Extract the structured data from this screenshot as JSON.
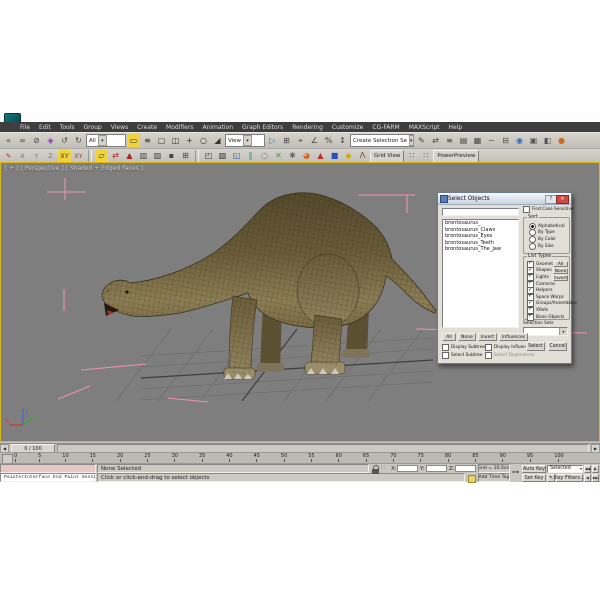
{
  "menu": {
    "items": [
      "File",
      "Edit",
      "Tools",
      "Group",
      "Views",
      "Create",
      "Modifiers",
      "Animation",
      "Graph Editors",
      "Rendering",
      "Customize",
      "CG-FARM",
      "MAXScript",
      "Help"
    ]
  },
  "toolbar1": {
    "selection_filter": "All",
    "ref_coord": "View",
    "named_sel": "Create Selection Se",
    "icons_a": [
      {
        "n": "flyout-collapse",
        "g": "«",
        "c": "#444"
      },
      {
        "n": "select-and-link",
        "g": "∞",
        "c": "#444"
      },
      {
        "n": "unlink-selection",
        "g": "⊘",
        "c": "#444"
      },
      {
        "n": "bind-to-space-warp",
        "g": "◈",
        "c": "#8a2fc0"
      },
      {
        "n": "undo",
        "g": "↺",
        "c": "#444"
      },
      {
        "n": "redo",
        "g": "↻",
        "c": "#444"
      }
    ],
    "icons_b": [
      {
        "n": "select-object",
        "g": "▭",
        "c": "#333",
        "b": "#f2d23a"
      },
      {
        "n": "select-by-name",
        "g": "≡",
        "c": "#333"
      },
      {
        "n": "rect-selection-region",
        "g": "▢",
        "c": "#333"
      },
      {
        "n": "window-crossing-toggle",
        "g": "◫",
        "c": "#333"
      },
      {
        "n": "select-and-move",
        "g": "+",
        "c": "#333"
      },
      {
        "n": "select-and-rotate",
        "g": "○",
        "c": "#333"
      },
      {
        "n": "select-and-scale",
        "g": "◢",
        "c": "#333"
      }
    ],
    "icons_c": [
      {
        "n": "select-and-manipulate",
        "g": "▷",
        "c": "#2a7ab0"
      },
      {
        "n": "keyboard-override",
        "g": "⊞",
        "c": "#444"
      },
      {
        "n": "snaps-toggle",
        "g": "⌖",
        "c": "#444"
      },
      {
        "n": "angle-snap",
        "g": "∠",
        "c": "#444"
      },
      {
        "n": "percent-snap",
        "g": "%",
        "c": "#444"
      },
      {
        "n": "spinner-snap",
        "g": "↕",
        "c": "#444"
      }
    ],
    "icons_d": [
      {
        "n": "edit-named-sets",
        "g": "✎",
        "c": "#444"
      },
      {
        "n": "mirror",
        "g": "⇄",
        "c": "#444"
      },
      {
        "n": "align",
        "g": "≡",
        "c": "#444"
      },
      {
        "n": "layer-manager",
        "g": "▤",
        "c": "#444"
      },
      {
        "n": "graphite-ribbon",
        "g": "▦",
        "c": "#444"
      },
      {
        "n": "curve-editor",
        "g": "~",
        "c": "#444"
      },
      {
        "n": "schematic-view",
        "g": "⊟",
        "c": "#444"
      },
      {
        "n": "material-editor",
        "g": "◉",
        "c": "#2f6db8"
      },
      {
        "n": "render-setup",
        "g": "▣",
        "c": "#555"
      },
      {
        "n": "rendered-frame-window",
        "g": "◧",
        "c": "#555"
      },
      {
        "n": "render-production",
        "g": "●",
        "c": "#d2691e"
      }
    ]
  },
  "toolbar2": {
    "grid_view": "Grid View",
    "power_preview": "PowerPreview",
    "icons_a": [
      {
        "n": "paint-deform",
        "g": "✎",
        "c": "#b22222"
      },
      {
        "n": "constraint-x",
        "t": "X",
        "c": "#777"
      },
      {
        "n": "constraint-y",
        "t": "Y",
        "c": "#777"
      },
      {
        "n": "constraint-z",
        "t": "Z",
        "c": "#777"
      },
      {
        "n": "constraint-xy",
        "t": "XY",
        "c": "#333",
        "b": "#f2d23a"
      },
      {
        "n": "constraint-xy-flyout",
        "t": "XY",
        "c": "#a33"
      }
    ],
    "icons_b": [
      {
        "n": "paint-options",
        "g": "▱",
        "c": "#333",
        "b": "#f2d23a"
      },
      {
        "n": "mirror-paint",
        "g": "⇄",
        "c": "#b22222"
      },
      {
        "n": "paint-blend",
        "g": "▲",
        "c": "#b22222"
      },
      {
        "n": "weight-table",
        "g": "▥",
        "c": "#444"
      },
      {
        "n": "weight-tool",
        "g": "▨",
        "c": "#444"
      },
      {
        "n": "shrink-selection",
        "g": "▪",
        "c": "#444"
      },
      {
        "n": "grow-selection",
        "g": "⊞",
        "c": "#444"
      }
    ],
    "icons_c": [
      {
        "n": "viewport-canvas",
        "g": "◰",
        "c": "#333"
      },
      {
        "n": "state-sets",
        "g": "▧",
        "c": "#333"
      },
      {
        "n": "civil-view",
        "g": "◱",
        "c": "#2a5fa8"
      },
      {
        "n": "populate",
        "g": "∥",
        "c": "#0a9aa0"
      },
      {
        "n": "lasso-selection",
        "g": "◌",
        "c": "#333"
      },
      {
        "n": "clear-selection",
        "g": "✕",
        "c": "#2a9f3a"
      },
      {
        "n": "settings-gear",
        "g": "✱",
        "c": "#666"
      },
      {
        "n": "render-teapot",
        "g": "◕",
        "c": "#d2691e"
      },
      {
        "n": "primitive-red",
        "g": "▲",
        "c": "#c03030"
      },
      {
        "n": "primitive-blue",
        "g": "■",
        "c": "#2a4fc0"
      },
      {
        "n": "primitive-yellow",
        "g": "◆",
        "c": "#d8a800"
      },
      {
        "n": "biped-figure",
        "g": "Λ",
        "c": "#7a4a20"
      }
    ],
    "icons_d": [
      {
        "n": "snap-grid-a",
        "g": "∷",
        "c": "#555"
      },
      {
        "n": "snap-grid-b",
        "g": "∷",
        "c": "#555"
      }
    ]
  },
  "viewport": {
    "label": "[ + ] [ Perspective ] [ Shaded + Edged Faces ]",
    "object": "brontosaurus wireframe model",
    "background": "#7e7e7e",
    "border_color": "#d8b71c",
    "bracket_color": "#ee92ac"
  },
  "dialog": {
    "title": "Select Objects",
    "search_value": "",
    "objects": [
      "brontosaurus_",
      "brontosaurus_Claws",
      "brontosaurus_Eyes",
      "brontosaurus_Teeth",
      "brontosaurus_The_Jaw"
    ],
    "find_case": "Find Case Sensitive",
    "sort": {
      "label": "Sort",
      "options": [
        "Alphabetical",
        "By Type",
        "By Color",
        "By Size"
      ],
      "selected": "Alphabetical"
    },
    "list_types": {
      "label": "List Types",
      "items": [
        "Geometry",
        "Shapes",
        "Lights",
        "Cameras",
        "Helpers",
        "Space Warps",
        "Groups/Assemblies",
        "XRefs",
        "Bone Objects"
      ],
      "buttons": [
        "All",
        "None",
        "Invert"
      ]
    },
    "selection_sets_label": "Selection Sets",
    "bottom_buttons": [
      "All",
      "None",
      "Invert",
      "Influences"
    ],
    "options": {
      "display_subtree": "Display Subtree",
      "display_influences": "Display Influences",
      "select_subtree": "Select Subtree",
      "select_dependents": "Select Dependents"
    },
    "select_label": "Select",
    "cancel_label": "Cancel"
  },
  "time_slider": {
    "frame_display": "0 / 100",
    "arrows": {
      "left": "◀",
      "right": "▶"
    }
  },
  "track_bar": {
    "ticks": [
      "0",
      "5",
      "10",
      "15",
      "20",
      "25",
      "30",
      "35",
      "40",
      "45",
      "50",
      "55",
      "60",
      "65",
      "70",
      "75",
      "80",
      "85",
      "90",
      "95",
      "100"
    ]
  },
  "status_bar": {
    "listener_bottom": "PainterInterface End Paint Session",
    "status_line": "None Selected",
    "prompt_line": "Click or click-and-drag to select objects",
    "coords": {
      "x_label": "X:",
      "y_label": "Y:",
      "z_label": "Z:",
      "x_value": "",
      "y_value": "",
      "z_value": ""
    },
    "grid_display": "Grid = 10.0cm",
    "add_time_tag": "Add Time Tag",
    "animation": {
      "auto_key": "Auto Key",
      "set_key": "Set Key",
      "selected_set": "Selected",
      "key_filters": "Key Filters..."
    },
    "playback": {
      "r1a": "◀◀",
      "r1b": "▶",
      "r2a": "◀",
      "r2b": "▶▶"
    }
  }
}
